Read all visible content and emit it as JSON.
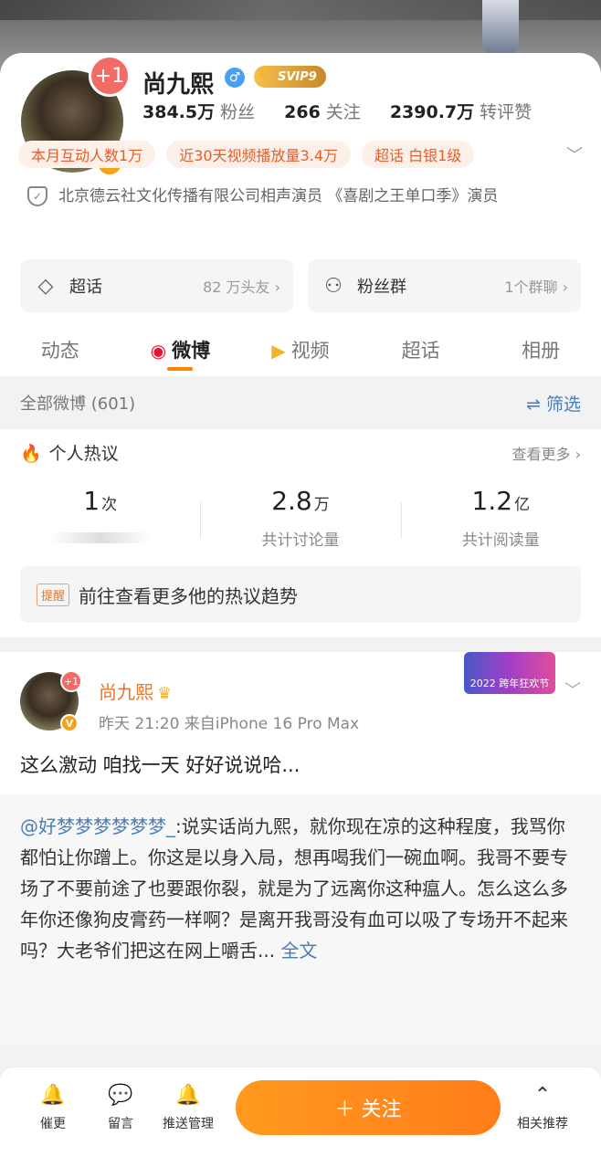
{
  "profile": {
    "plus_badge": "+1",
    "verified_letter": "V",
    "name": "尚九熙",
    "gender_symbol": "♂",
    "svip": "SVIP9",
    "stats": [
      {
        "value": "384.5万",
        "label": "粉丝"
      },
      {
        "value": "266",
        "label": "关注"
      },
      {
        "value": "2390.7万",
        "label": "转评赞"
      }
    ],
    "tags": [
      "本月互动人数1万",
      "近30天视频播放量3.4万",
      "超话 白银1级"
    ],
    "verification": "北京德云社文化传播有限公司相声演员 《喜剧之王单口季》演员",
    "cards": [
      {
        "icon": "diamond-icon",
        "label": "超话",
        "meta": "82 万头友 ›"
      },
      {
        "icon": "group-icon",
        "label": "粉丝群",
        "meta": "1个群聊 ›"
      }
    ],
    "tabs": [
      "动态",
      "微博",
      "视频",
      "超话",
      "相册"
    ]
  },
  "filter": {
    "label": "全部微博 (601)",
    "button": "筛选"
  },
  "hot": {
    "title": "个人热议",
    "more": "查看更多 ›",
    "stats": [
      {
        "num": "1",
        "unit": "次",
        "label": ""
      },
      {
        "num": "2.8",
        "unit": "万",
        "label": "共计讨论量"
      },
      {
        "num": "1.2",
        "unit": "亿",
        "label": "共计阅读量"
      }
    ],
    "hint_badge": "提醒",
    "hint_text": "前往查看更多他的热议趋势"
  },
  "post": {
    "plus_badge": "+1",
    "verified_letter": "V",
    "author": "尚九熙",
    "time_source": "昨天 21:20  来自iPhone 16 Pro Max",
    "sticker": "2022 跨年狂欢节",
    "text": "这么激动 咱找一天 好好说说哈...",
    "repost_mention": "@好梦梦梦梦梦梦_",
    "repost_text": ":说实话尚九熙，就你现在凉的这种程度，我骂你都怕让你蹭上。你这是以身入局，想再喝我们一碗血啊。我哥不要专场了不要前途了也要跟你裂，就是为了远离你这种瘟人。怎么这么多年你还像狗皮膏药一样啊？是离开我哥没有血可以吸了专场开不起来吗？大老爷们把这在网上嚼舌...",
    "repost_full": "全文"
  },
  "bottom": {
    "items": [
      {
        "icon": "bell-icon",
        "label": "催更"
      },
      {
        "icon": "comment-icon",
        "label": "留言"
      },
      {
        "icon": "bell-plus-icon",
        "label": "推送管理"
      },
      {
        "icon": "chevron-up-circle-icon",
        "label": "相关推荐"
      }
    ],
    "follow": "＋ 关注"
  }
}
